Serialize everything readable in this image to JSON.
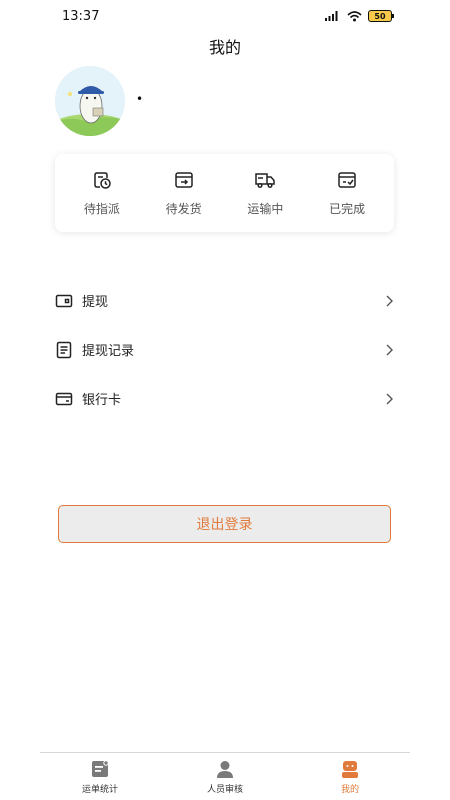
{
  "status": {
    "time": "13:37",
    "battery": "50"
  },
  "header": {
    "title": "我的"
  },
  "profile": {
    "name": "•"
  },
  "orders": [
    {
      "label": "待指派",
      "icon": "clock-document-icon"
    },
    {
      "label": "待发货",
      "icon": "outbox-icon"
    },
    {
      "label": "运输中",
      "icon": "truck-icon"
    },
    {
      "label": "已完成",
      "icon": "done-box-icon"
    }
  ],
  "menu": [
    {
      "label": "提现",
      "icon": "wallet-icon"
    },
    {
      "label": "提现记录",
      "icon": "record-list-icon"
    },
    {
      "label": "银行卡",
      "icon": "bank-card-icon"
    }
  ],
  "logout": {
    "label": "退出登录"
  },
  "tabs": [
    {
      "label": "运单统计",
      "icon": "waybill-icon",
      "active": false
    },
    {
      "label": "人员审核",
      "icon": "person-icon",
      "active": false
    },
    {
      "label": "我的",
      "icon": "profile-icon",
      "active": true
    }
  ],
  "colors": {
    "accent": "#e07b3c"
  }
}
